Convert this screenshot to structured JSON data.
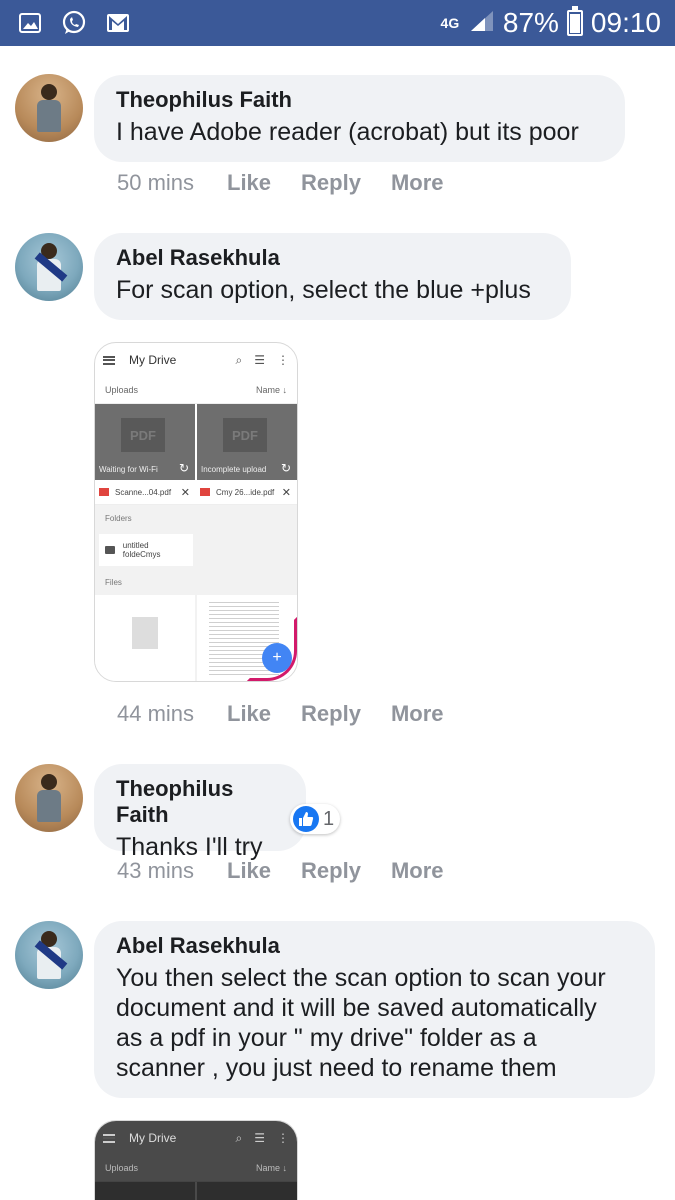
{
  "status_bar": {
    "network": "4G",
    "battery_percent": "87%",
    "battery_level": 0.87,
    "time": "09:10",
    "notification_icons": [
      "gallery-icon",
      "whatsapp-icon",
      "gmail-icon"
    ]
  },
  "comments": [
    {
      "author": "Theophilus Faith",
      "text": "I have Adobe reader (acrobat) but its poor",
      "time": "50 mins",
      "actions": [
        "Like",
        "Reply",
        "More"
      ]
    },
    {
      "author": "Abel Rasekhula",
      "text": "For scan option, select the blue +plus",
      "time": "44 mins",
      "actions": [
        "Like",
        "Reply",
        "More"
      ],
      "attachment": {
        "title": "My Drive",
        "uploads_label": "Uploads",
        "sort_label": "Name",
        "tiles": [
          {
            "badge": "PDF",
            "caption": "Waiting for Wi-Fi"
          },
          {
            "badge": "PDF",
            "caption": "Incomplete upload"
          }
        ],
        "files": [
          "Scanne...04.pdf",
          "Cmy 26...ide.pdf"
        ],
        "folders_label": "Folders",
        "folder_name": "untitled foldeCmys",
        "files_label": "Files",
        "fab": "+"
      }
    },
    {
      "author": "Theophilus Faith",
      "text": "Thanks I'll try",
      "time": "43 mins",
      "actions": [
        "Like",
        "Reply",
        "More"
      ],
      "reaction_count": "1"
    },
    {
      "author": "Abel Rasekhula",
      "text_lines": [
        "You then select the scan option to scan your",
        "document and it will be saved automatically",
        "as a pdf in your \" my drive\" folder as a",
        "scanner , you just need to rename them"
      ],
      "attachment": {
        "title": "My Drive",
        "uploads_label": "Uploads",
        "sort_label": "Name"
      }
    }
  ],
  "colors": {
    "status_bar": "#3b5998",
    "bubble": "#f0f2f5",
    "meta": "#90949c",
    "like_blue": "#1877f2",
    "fab_blue": "#4285f4",
    "annotation": "#d21a6a"
  }
}
